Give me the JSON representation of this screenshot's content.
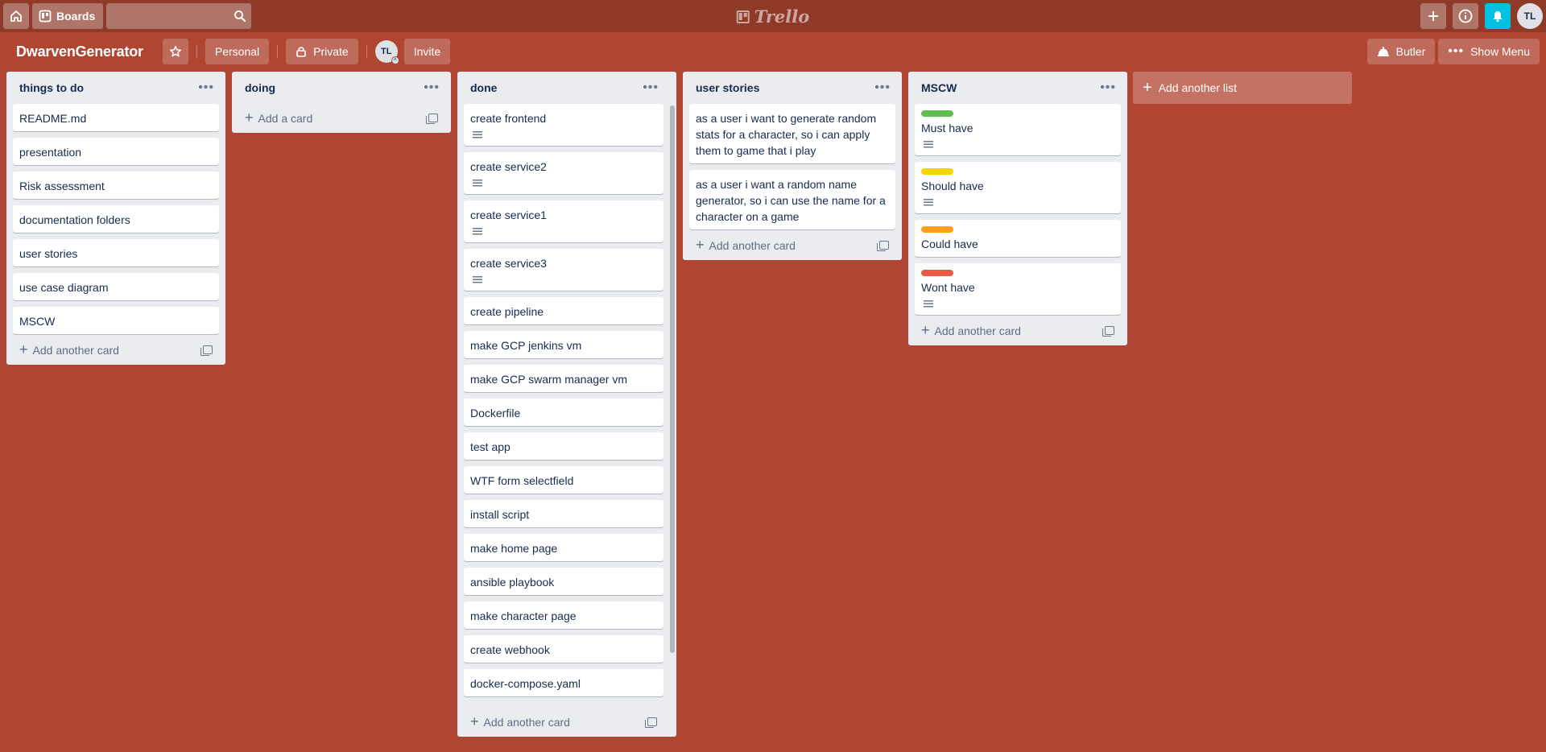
{
  "header": {
    "boards_label": "Boards",
    "search_placeholder": "",
    "logo_text": "Trello",
    "avatar_initials": "TL"
  },
  "board": {
    "title": "DwarvenGenerator",
    "team_label": "Personal",
    "visibility_label": "Private",
    "member_initials": "TL",
    "invite_label": "Invite",
    "butler_label": "Butler",
    "menu_label": "Show Menu"
  },
  "lists": [
    {
      "title": "things to do",
      "add_label": "Add another card",
      "cards": [
        {
          "title": "README.md",
          "desc": false
        },
        {
          "title": "presentation",
          "desc": false
        },
        {
          "title": "Risk assessment",
          "desc": false
        },
        {
          "title": "documentation folders",
          "desc": false
        },
        {
          "title": "user stories",
          "desc": false
        },
        {
          "title": "use case diagram",
          "desc": false
        },
        {
          "title": "MSCW",
          "desc": false
        }
      ]
    },
    {
      "title": "doing",
      "add_label": "Add a card",
      "cards": []
    },
    {
      "title": "done",
      "add_label": "Add another card",
      "cards": [
        {
          "title": "create frontend",
          "desc": true
        },
        {
          "title": "create service2",
          "desc": true
        },
        {
          "title": "create service1",
          "desc": true
        },
        {
          "title": "create service3",
          "desc": true
        },
        {
          "title": "create pipeline",
          "desc": false
        },
        {
          "title": "make GCP jenkins vm",
          "desc": false
        },
        {
          "title": "make GCP swarm manager vm",
          "desc": false
        },
        {
          "title": "Dockerfile",
          "desc": false
        },
        {
          "title": "test app",
          "desc": false
        },
        {
          "title": "WTF form selectfield",
          "desc": false
        },
        {
          "title": "install script",
          "desc": false
        },
        {
          "title": "make home page",
          "desc": false
        },
        {
          "title": "ansible playbook",
          "desc": false
        },
        {
          "title": "make character page",
          "desc": false
        },
        {
          "title": "create webhook",
          "desc": false
        },
        {
          "title": "docker-compose.yaml",
          "desc": false
        }
      ]
    },
    {
      "title": "user stories",
      "add_label": "Add another card",
      "cards": [
        {
          "title": "as a user i want to generate random stats for a character, so i can apply them to game that i play",
          "desc": false
        },
        {
          "title": "as a user i want a random name generator, so i can use the name for a character on a game",
          "desc": false
        }
      ]
    },
    {
      "title": "MSCW",
      "add_label": "Add another card",
      "cards": [
        {
          "title": "Must have",
          "desc": true,
          "label_color": "#61bd4f"
        },
        {
          "title": "Should have",
          "desc": true,
          "label_color": "#f2d600"
        },
        {
          "title": "Could have",
          "desc": false,
          "label_color": "#ff9f1a"
        },
        {
          "title": "Wont have",
          "desc": true,
          "label_color": "#eb5a46"
        }
      ]
    }
  ],
  "add_list_label": "Add another list",
  "colors": {
    "board_background": "#b04632",
    "header_background": "#8f3a29",
    "list_background": "#ebecf0",
    "notification_accent": "#00c2e0"
  }
}
